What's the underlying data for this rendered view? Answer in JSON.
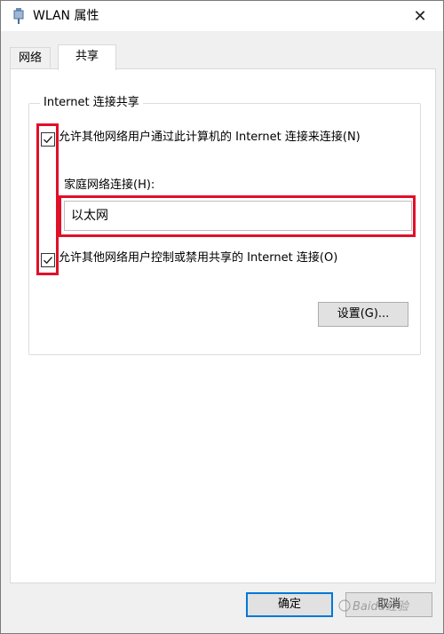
{
  "window": {
    "title": "WLAN 属性",
    "close_glyph": "✕"
  },
  "tabs": [
    {
      "label": "网络",
      "selected": false
    },
    {
      "label": "共享",
      "selected": true
    }
  ],
  "sharing": {
    "group_title": "Internet 连接共享",
    "allow_share_label": "允许其他网络用户通过此计算机的 Internet 连接来连接(N)",
    "allow_share_checked": true,
    "home_network_label": "家庭网络连接(H):",
    "home_network_value": "以太网",
    "allow_control_label": "允许其他网络用户控制或禁用共享的 Internet 连接(O)",
    "allow_control_checked": true,
    "settings_button": "设置(G)..."
  },
  "footer": {
    "ok_label": "确定",
    "cancel_label": "取消"
  },
  "watermark_text": "Baidu经验",
  "colors": {
    "highlight": "#e0102a",
    "ok_border": "#0078d7"
  }
}
